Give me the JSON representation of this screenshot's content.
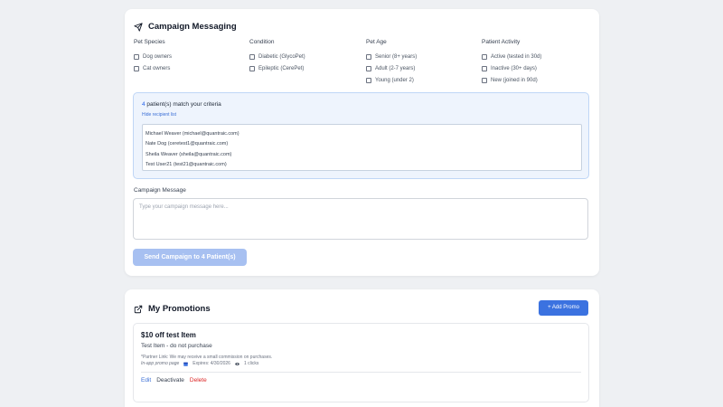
{
  "campaign": {
    "title": "Campaign Messaging",
    "icon": "send-icon",
    "filters": [
      {
        "heading": "Pet Species",
        "options": [
          "Dog owners",
          "Cat owners"
        ]
      },
      {
        "heading": "Condition",
        "options": [
          "Diabetic (GlycoPet)",
          "Epileptic (CerePet)"
        ]
      },
      {
        "heading": "Pet Age",
        "options": [
          "Senior (8+ years)",
          "Adult (2-7 years)",
          "Young (under 2)"
        ]
      },
      {
        "heading": "Patient Activity",
        "options": [
          "Active (tested in 30d)",
          "Inactive (30+ days)",
          "New (joined in 90d)"
        ]
      }
    ],
    "match_count": "4",
    "match_suffix": " patient(s) match your criteria",
    "hide_link": "Hide recipient list",
    "recipients": [
      "Michael Weaver (michael@quantraic.com)",
      "Nate Dog (ceretest1@quantraic.com)",
      "Sheila Weaver (sheila@quantraic.com)",
      "Test User21 (test21@quantraic.com)"
    ],
    "message_label": "Campaign Message",
    "message_placeholder": "Type your campaign message here...",
    "message_value": "",
    "send_label": "Send Campaign to 4 Patient(s)",
    "colors": {
      "send_disabled": "#a7c0f1",
      "match_bg": "#eef4fd",
      "link": "#3b6fd6"
    }
  },
  "promotions": {
    "title": "My Promotions",
    "icon": "external-link-icon",
    "add_label": "+ Add Promo",
    "items": [
      {
        "title": "$10 off test Item",
        "description": "Test Item - do not purchase",
        "note": "*Partner Link: We may receive a small commission on purchases.",
        "type": "In-app promo page",
        "expires": "Expires: 4/30/2026",
        "clicks": "1 clicks",
        "actions": {
          "edit": "Edit",
          "deactivate": "Deactivate",
          "delete": "Delete"
        }
      }
    ],
    "colors": {
      "add_button": "#3b72e0",
      "delete": "#dc2626"
    }
  }
}
